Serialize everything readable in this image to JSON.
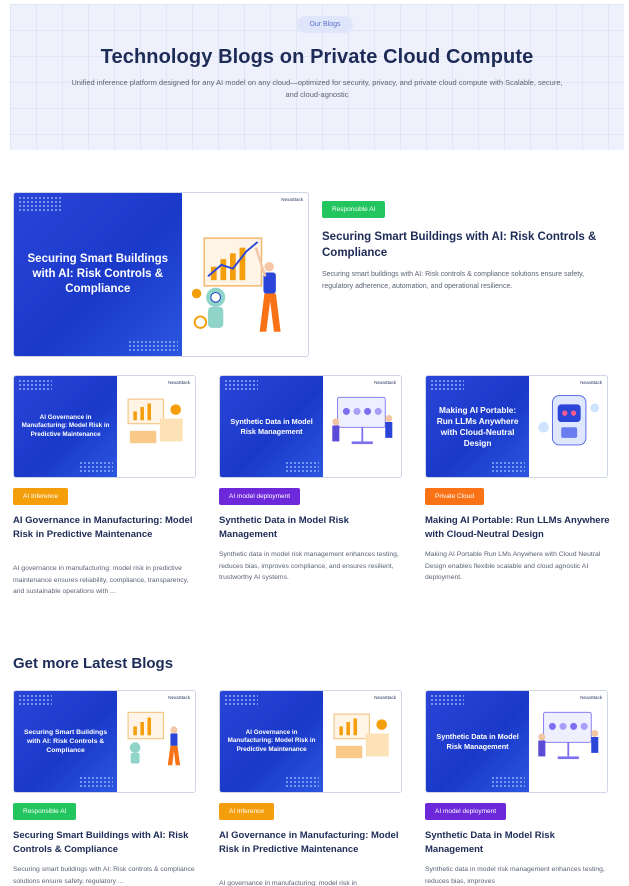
{
  "hero": {
    "pill": "Our Blogs",
    "title": "Technology Blogs on Private Cloud Compute",
    "subtitle": "Unified inference platform designed for any AI model on any cloud—optimized for security, privacy, and private cloud compute with Scalable, secure, and cloud-agnostic"
  },
  "brand": {
    "logo_text": "NexaStack"
  },
  "featured": {
    "image_text": "Securing Smart Buildings with AI: Risk Controls & Compliance",
    "tag": "Responsible AI",
    "title": "Securing Smart Buildings with AI: Risk Controls & Compliance",
    "description": "Securing smart buildings with AI: Risk controls & compliance solutions ensure safety, regulatory adherence, automation, and operational resilience."
  },
  "cards": [
    {
      "image_text": "AI Governance in Manufacturing: Model Risk in Predictive Maintenance",
      "tag": "AI Inference",
      "title": "AI Governance in Manufacturing: Model Risk in Predictive Maintenance",
      "description": "AI governance in manufacturing: model risk in predictive maintenance ensures reliability, compliance, transparency, and sustainable operations with ..."
    },
    {
      "image_text": "Synthetic Data in Model Risk Management",
      "tag": "AI model deployment",
      "title": "Synthetic Data in Model Risk Management",
      "description": "Synthetic data in model risk management enhances testing, reduces bias, improves compliance, and ensures resilient, trustworthy AI systems."
    },
    {
      "image_text": "Making AI Portable: Run LLMs Anywhere with Cloud-Neutral Design",
      "tag": "Private Cloud",
      "title": "Making AI Portable: Run LLMs Anywhere with Cloud-Neutral Design",
      "description": "Making AI Portable Run LMs Anywhere with Cloud Neutral Design enables flexible scalable and cloud agnostic AI deployment."
    }
  ],
  "latest": {
    "heading": "Get more Latest Blogs",
    "cards": [
      {
        "image_text": "Securing Smart Buildings with AI: Risk Controls & Compliance",
        "tag": "Responsible AI",
        "title": "Securing Smart Buildings with AI: Risk Controls & Compliance",
        "description": "Securing smart buildings with AI: Risk controls & compliance solutions ensure safety, regulatory ..."
      },
      {
        "image_text": "AI Governance in Manufacturing: Model Risk in Predictive Maintenance",
        "tag": "AI Inference",
        "title": "AI Governance in Manufacturing: Model Risk in Predictive Maintenance",
        "description": "AI governance in manufacturing: model risk in"
      },
      {
        "image_text": "Synthetic Data in Model Risk Management",
        "tag": "AI model deployment",
        "title": "Synthetic Data in Model Risk Management",
        "description": "Synthetic data in model risk management enhances testing, reduces bias, improves"
      }
    ]
  },
  "colors": {
    "accent_blue": "#1a39c9",
    "heading": "#1d2b57",
    "tag_green": "#22c55e",
    "tag_orange": "#f59e0b",
    "tag_purple": "#6d28d9",
    "tag_deeporange": "#f97316"
  }
}
